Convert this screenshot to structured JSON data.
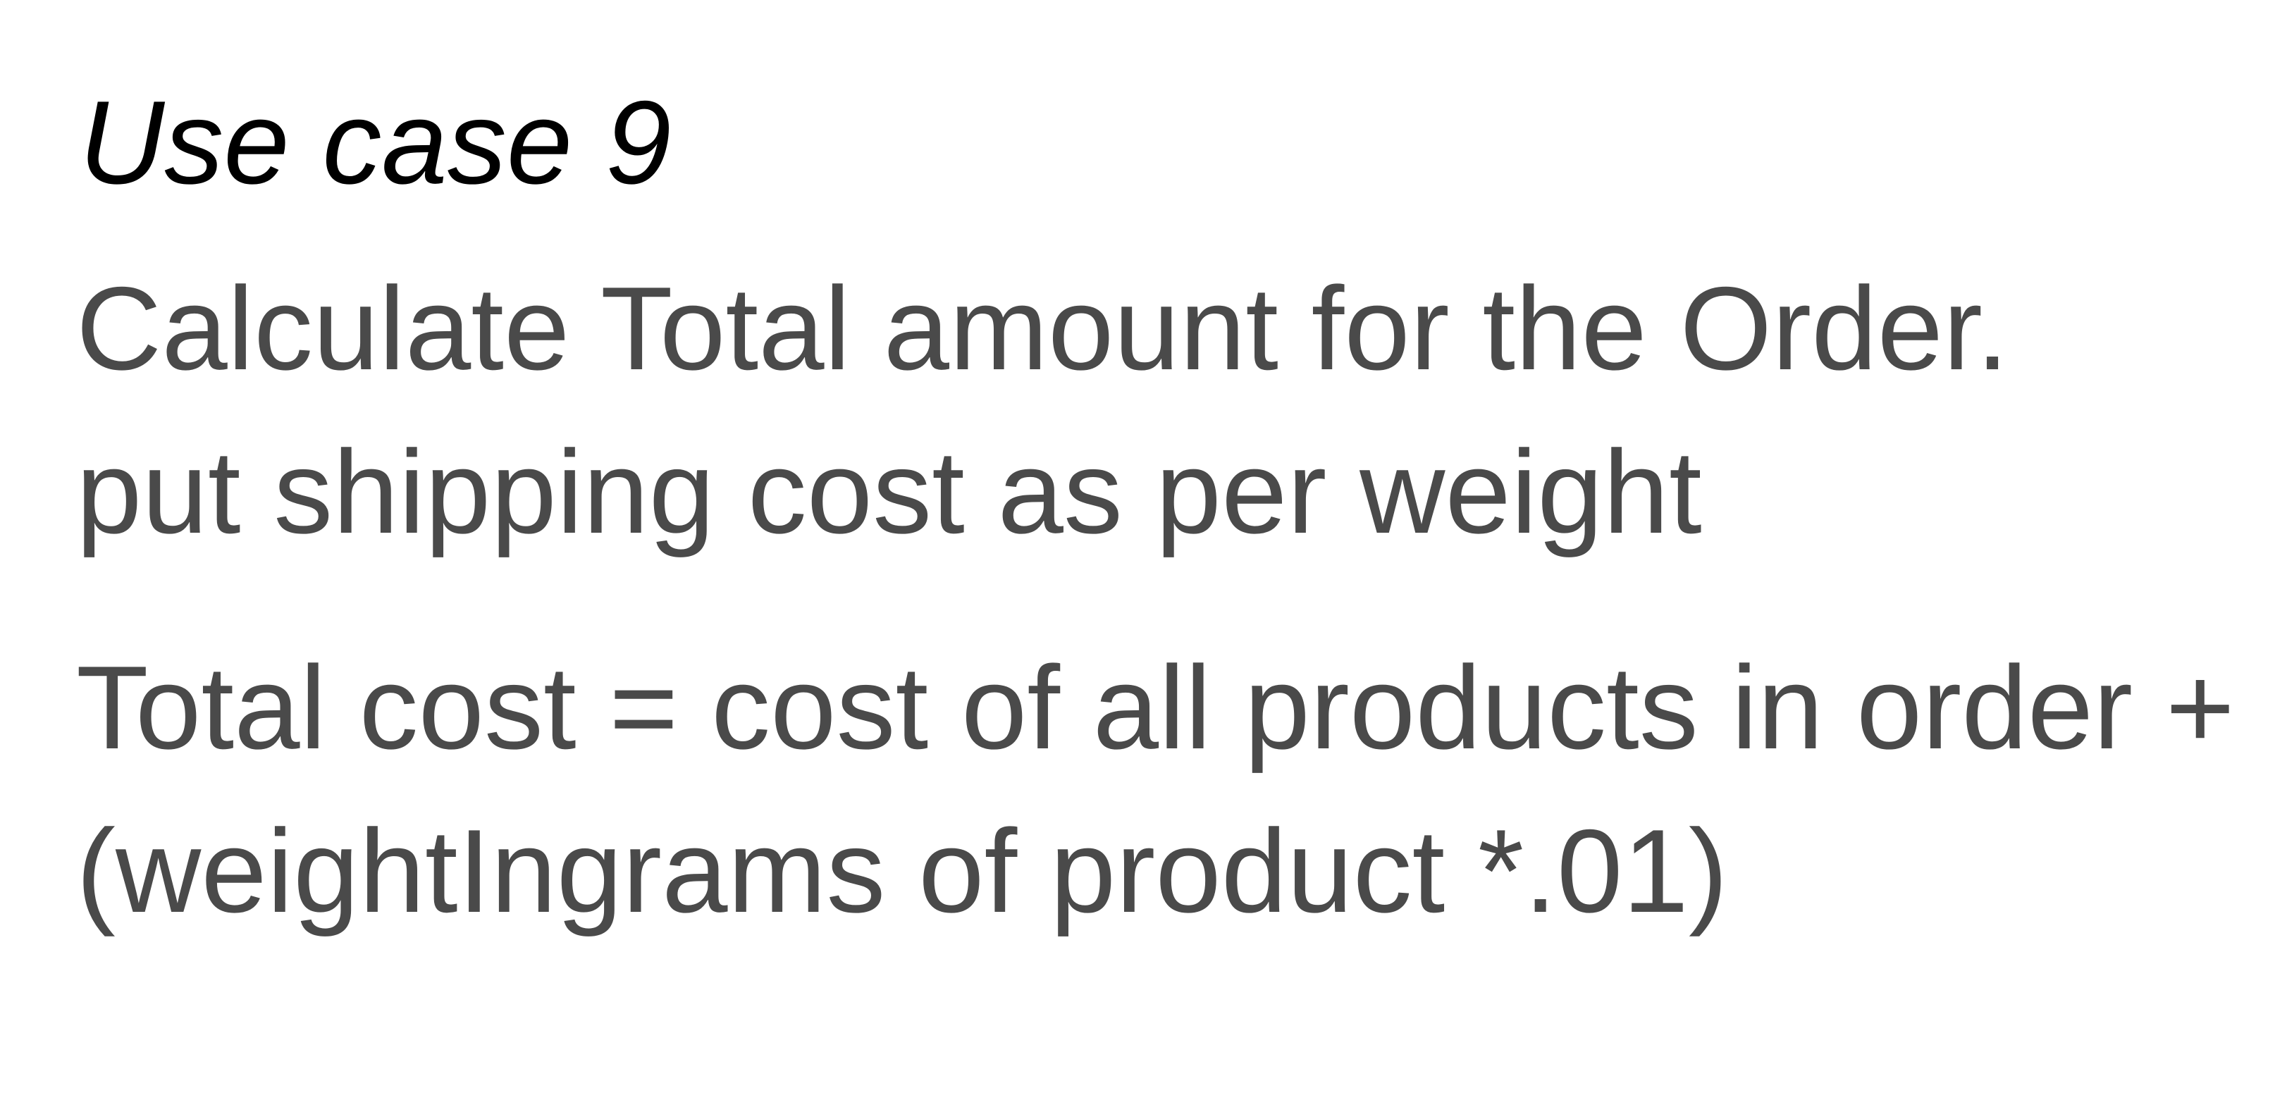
{
  "slide": {
    "title": "Use case 9",
    "paragraphs": [
      {
        "lines": [
          "Calculate Total amount for the Order.",
          "put shipping cost as per weight"
        ]
      },
      {
        "lines": [
          "Total cost = cost of all products in order +",
          "(weightIngrams of product *.01)"
        ]
      }
    ]
  }
}
